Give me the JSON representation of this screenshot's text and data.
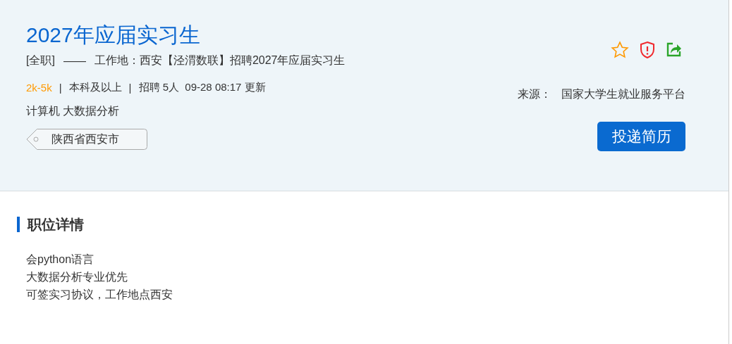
{
  "job": {
    "title": "2027年应届实习生",
    "type": "[全职]",
    "dash": "——",
    "subtitle": "工作地：西安【泾渭数联】招聘2027年应届实习生",
    "salary": "2k-5k",
    "separator": "|",
    "education": "本科及以上",
    "recruit": "招聘 5人  09-28 08:17 更新",
    "keywords": "计算机 大数据分析",
    "location_tag": "陕西省西安市",
    "source_label": "来源：",
    "source": "国家大学生就业服务平台",
    "apply_button": "投递简历",
    "favorited": false
  },
  "details": {
    "heading": "职位详情",
    "lines": [
      "会python语言",
      "大数据分析专业优先",
      "可签实习协议，工作地点西安"
    ]
  }
}
